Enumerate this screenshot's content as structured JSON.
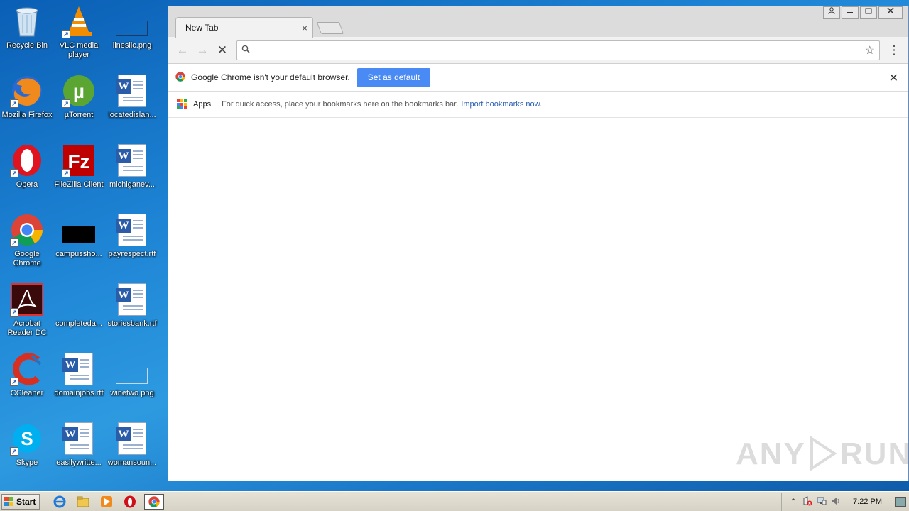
{
  "desktop": {
    "icons": [
      {
        "label": "Recycle Bin"
      },
      {
        "label": "VLC media player"
      },
      {
        "label": "linesllc.png"
      },
      {
        "label": "Mozilla Firefox"
      },
      {
        "label": "µTorrent"
      },
      {
        "label": "locatedislan..."
      },
      {
        "label": "Opera"
      },
      {
        "label": "FileZilla Client"
      },
      {
        "label": "michiganev..."
      },
      {
        "label": "Google Chrome"
      },
      {
        "label": "campussho..."
      },
      {
        "label": "payrespect.rtf"
      },
      {
        "label": "Acrobat Reader DC"
      },
      {
        "label": "completeda..."
      },
      {
        "label": "storiesbank.rtf"
      },
      {
        "label": "CCleaner"
      },
      {
        "label": "domainjobs.rtf"
      },
      {
        "label": "winetwo.png"
      },
      {
        "label": "Skype"
      },
      {
        "label": "easilywritte..."
      },
      {
        "label": "womansoun..."
      }
    ]
  },
  "browser": {
    "tab_title": "New Tab",
    "tab_close": "×",
    "omnibox_value": "",
    "infobar_text": "Google Chrome isn't your default browser.",
    "set_default_label": "Set as default",
    "bookmarks_apps": "Apps",
    "bookmarks_hint": "For quick access, place your bookmarks here on the bookmarks bar.",
    "bookmarks_import": "Import bookmarks now..."
  },
  "watermark": {
    "text_left": "ANY",
    "text_right": "RUN"
  },
  "taskbar": {
    "start_label": "Start",
    "clock": "7:22 PM"
  },
  "colors": {
    "accent": "#4a8af4",
    "link": "#2a5db0"
  }
}
